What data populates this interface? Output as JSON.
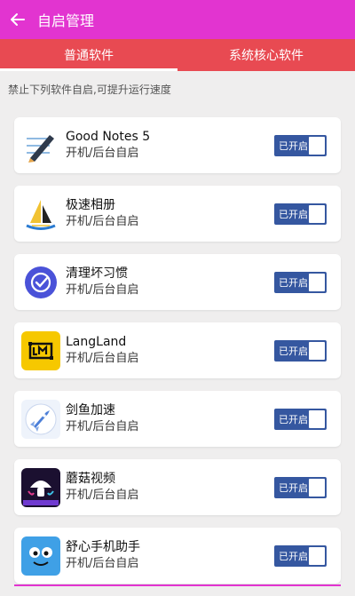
{
  "header": {
    "title": "自启管理",
    "back_icon": "arrow-left-icon"
  },
  "tabs": [
    {
      "label": "普通软件",
      "active": true
    },
    {
      "label": "系统核心软件",
      "active": false
    }
  ],
  "hint": "禁止下列软件自启,可提升运行速度",
  "apps": [
    {
      "name": "Good Notes 5",
      "subtitle": "开机/后台自启",
      "toggle_label": "已开启",
      "icon": "goodnotes-icon"
    },
    {
      "name": "极速相册",
      "subtitle": "开机/后台自启",
      "toggle_label": "已开启",
      "icon": "sailboat-icon"
    },
    {
      "name": "清理坏习惯",
      "subtitle": "开机/后台自启",
      "toggle_label": "已开启",
      "icon": "check-circle-icon"
    },
    {
      "name": "LangLand",
      "subtitle": "开机/后台自启",
      "toggle_label": "已开启",
      "icon": "langland-icon"
    },
    {
      "name": "剑鱼加速",
      "subtitle": "开机/后台自启",
      "toggle_label": "已开启",
      "icon": "rocket-icon"
    },
    {
      "name": "蘑菇视频",
      "subtitle": "开机/后台自启",
      "toggle_label": "已开启",
      "icon": "mushroom-icon"
    },
    {
      "name": "舒心手机助手",
      "subtitle": "开机/后台自启",
      "toggle_label": "已开启",
      "icon": "smiley-face-icon"
    }
  ],
  "colors": {
    "appbar": "#e234d0",
    "tabs": "#e84a52",
    "toggle_on": "#3557a0"
  }
}
